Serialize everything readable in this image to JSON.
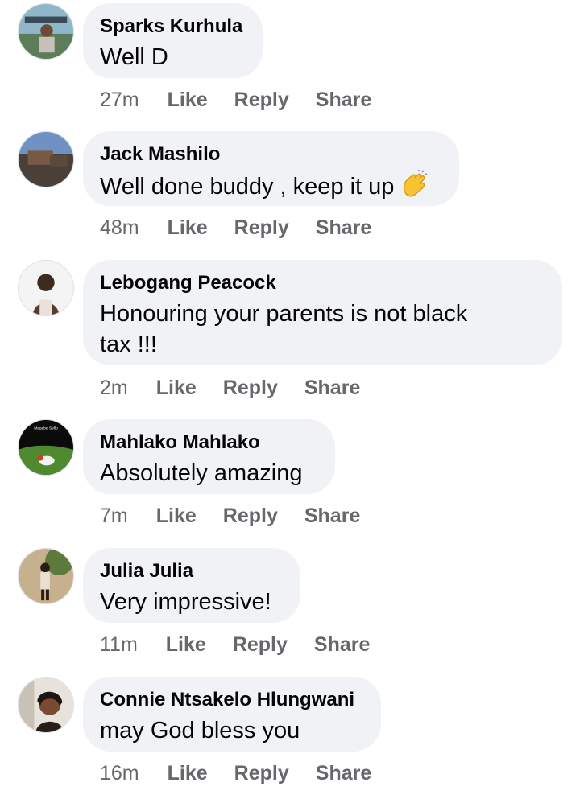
{
  "comments": [
    {
      "author": "Sparks Kurhula",
      "text": "Well D",
      "time": "27m",
      "avatar": "avatar-sparks"
    },
    {
      "author": "Jack Mashilo",
      "text": "Well done buddy , keep it up",
      "time": "48m",
      "emoji": "clapping-hands-icon",
      "avatar": "avatar-jack"
    },
    {
      "author": "Lebogang Peacock",
      "text": "Honouring your parents is not black tax !!!",
      "time": "2m",
      "avatar": "avatar-lebogang"
    },
    {
      "author": "Mahlako Mahlako",
      "text": "Absolutely amazing",
      "time": "7m",
      "avatar": "avatar-mahlako",
      "avatar_caption": "Magabe Sello"
    },
    {
      "author": "Julia Julia",
      "text": "Very impressive!",
      "time": "11m",
      "avatar": "avatar-julia"
    },
    {
      "author": "Connie Ntsakelo Hlungwani",
      "text": "may God bless you",
      "time": "16m",
      "avatar": "avatar-connie"
    }
  ],
  "actions": {
    "like": "Like",
    "reply": "Reply",
    "share": "Share"
  },
  "colors": {
    "bubble": "#f0f2f5",
    "meta": "#65676b",
    "text": "#050505"
  }
}
